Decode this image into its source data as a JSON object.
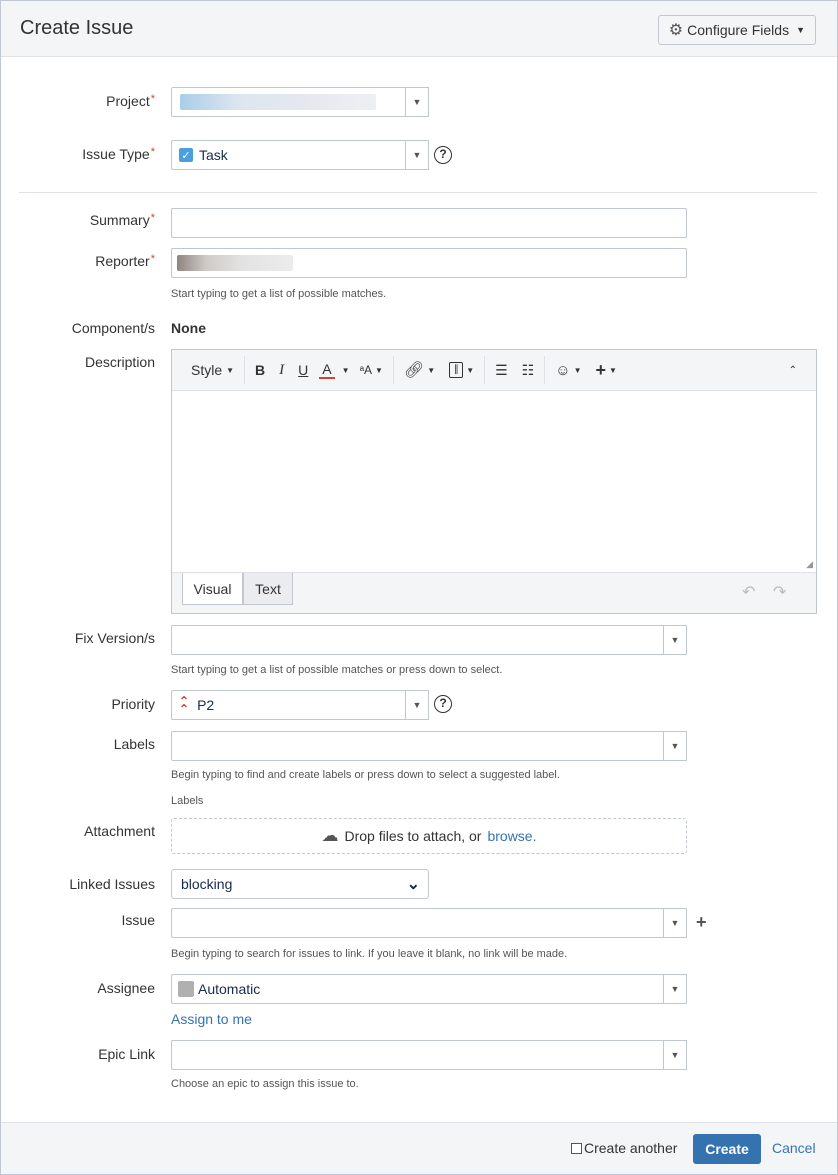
{
  "dialog": {
    "title": "Create Issue",
    "configure_label": "Configure Fields"
  },
  "fields": {
    "project": {
      "label": "Project"
    },
    "issue_type": {
      "label": "Issue Type",
      "value": "Task"
    },
    "summary": {
      "label": "Summary",
      "value": ""
    },
    "reporter": {
      "label": "Reporter",
      "hint": "Start typing to get a list of possible matches."
    },
    "components": {
      "label": "Component/s",
      "value": "None"
    },
    "description": {
      "label": "Description",
      "toolbar": {
        "style": "Style",
        "bold": "B",
        "italic": "I",
        "underline": "U",
        "color": "A"
      },
      "tabs": [
        "Visual",
        "Text"
      ]
    },
    "fix_versions": {
      "label": "Fix Version/s",
      "hint": "Start typing to get a list of possible matches or press down to select."
    },
    "priority": {
      "label": "Priority",
      "value": "P2"
    },
    "labels": {
      "label": "Labels",
      "hint": "Begin typing to find and create labels or press down to select a suggested label.",
      "sublabel": "Labels"
    },
    "attachment": {
      "label": "Attachment",
      "drop_text": "Drop files to attach, or",
      "browse": "browse."
    },
    "linked_issues": {
      "label": "Linked Issues",
      "value": "blocking"
    },
    "issue": {
      "label": "Issue",
      "hint": "Begin typing to search for issues to link. If you leave it blank, no link will be made."
    },
    "assignee": {
      "label": "Assignee",
      "value": "Automatic",
      "assign_to_me": "Assign to me"
    },
    "epic_link": {
      "label": "Epic Link",
      "hint": "Choose an epic to assign this issue to."
    }
  },
  "footer": {
    "create_another": "Create another",
    "create": "Create",
    "cancel": "Cancel"
  },
  "colors": {
    "accent": "#3572b0",
    "required": "#d04437",
    "priority": "#d04437"
  }
}
